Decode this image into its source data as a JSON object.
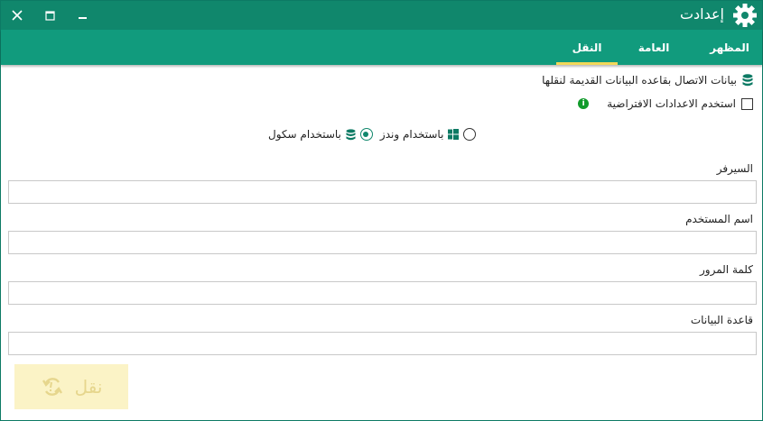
{
  "window": {
    "title": "إعدادت",
    "controls": {
      "close": "✕",
      "maximize": "☐",
      "minimize": "‒"
    }
  },
  "tabs": [
    {
      "label": "المظهر",
      "active": false
    },
    {
      "label": "العامة",
      "active": false
    },
    {
      "label": "النقل",
      "active": true
    }
  ],
  "section": {
    "heading": "بيانات الاتصال بقاعده البيانات القديمة لنقلها",
    "use_defaults_label": "استخدم الاعدادات الافتراضية",
    "use_defaults_checked": false,
    "info_icon": "i",
    "auth_windows_label": "باستخدام وندز",
    "auth_sql_label": "باستخدام سكول",
    "auth_selected": "sql"
  },
  "fields": {
    "server_label": "السيرفر",
    "server_value": "",
    "username_label": "اسم المستخدم",
    "username_value": "",
    "password_label": "كلمة المرور",
    "password_value": "",
    "database_label": "قاعدة البيانات",
    "database_value": ""
  },
  "actions": {
    "transfer_label": "نقل",
    "transfer_enabled": false
  },
  "colors": {
    "titlebar": "#10876c",
    "tabbar": "#119b7d",
    "tab_indicator": "#f2d85a",
    "button_bg_disabled": "#fbf3c6",
    "button_fg_disabled": "#e6d68d"
  }
}
